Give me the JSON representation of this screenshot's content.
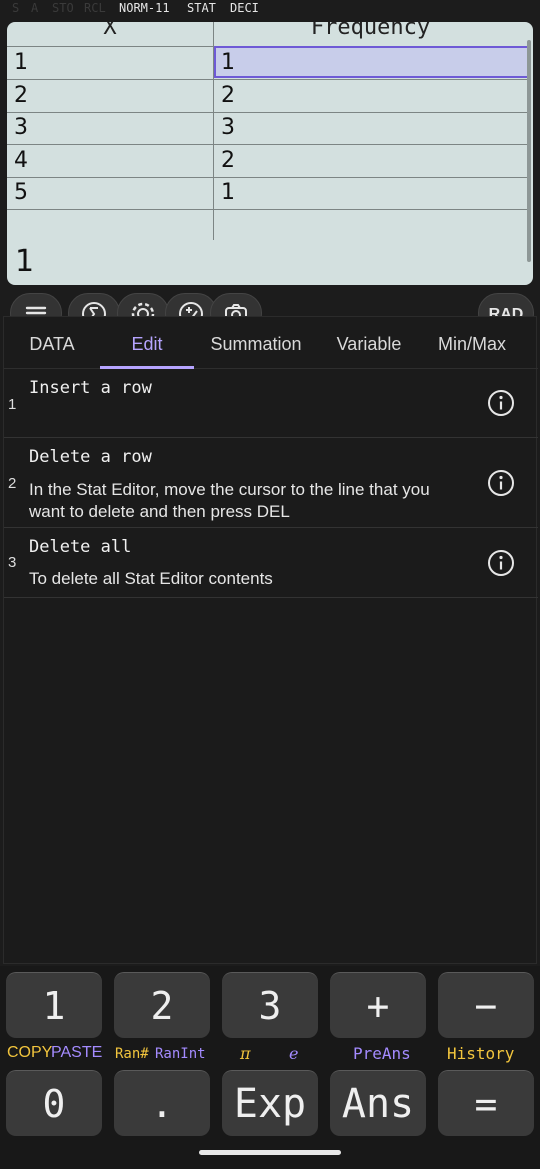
{
  "status_bar": {
    "dim_indicators": [
      "S",
      "A",
      "STO",
      "RCL"
    ],
    "active_indicators": [
      "NORM-11",
      "STAT",
      "DECI"
    ]
  },
  "stat_editor": {
    "columns": [
      "X",
      "Frequency"
    ],
    "rows": [
      {
        "x": "1",
        "freq": "1"
      },
      {
        "x": "2",
        "freq": "2"
      },
      {
        "x": "3",
        "freq": "3"
      },
      {
        "x": "4",
        "freq": "2"
      },
      {
        "x": "5",
        "freq": "1"
      }
    ],
    "selected": "row 1, Frequency",
    "entry_line": "1"
  },
  "toolbar": {
    "icons": [
      "menu-icon",
      "sigma-icon",
      "settings-icon",
      "plus-minus-icon",
      "camera-icon"
    ],
    "angle_mode": "RAD"
  },
  "help_panel": {
    "tabs": [
      "DATA",
      "Edit",
      "Summation",
      "Variable",
      "Min/Max"
    ],
    "active_tab": "Edit",
    "items": [
      {
        "num": "1",
        "title": "Insert a row",
        "desc": ""
      },
      {
        "num": "2",
        "title": "Delete a row",
        "desc": "In the Stat Editor, move the cursor to the line that you want to delete and then press DEL"
      },
      {
        "num": "3",
        "title": "Delete all",
        "desc": "To delete all Stat Editor contents"
      }
    ]
  },
  "keypad": {
    "row1": [
      "1",
      "2",
      "3",
      "+",
      "−"
    ],
    "row2": [
      "0",
      ".",
      "Exp",
      "Ans",
      "="
    ],
    "shift_labels": [
      "COPY",
      "PASTE",
      "Ran#",
      "RanInt",
      "π",
      "e",
      "PreAns",
      "History"
    ]
  },
  "colors": {
    "display_bg": "#d3e0df",
    "accent": "#b6a4ff",
    "shift_yellow": "#f2c53d",
    "shift_purple": "#a48bff"
  }
}
